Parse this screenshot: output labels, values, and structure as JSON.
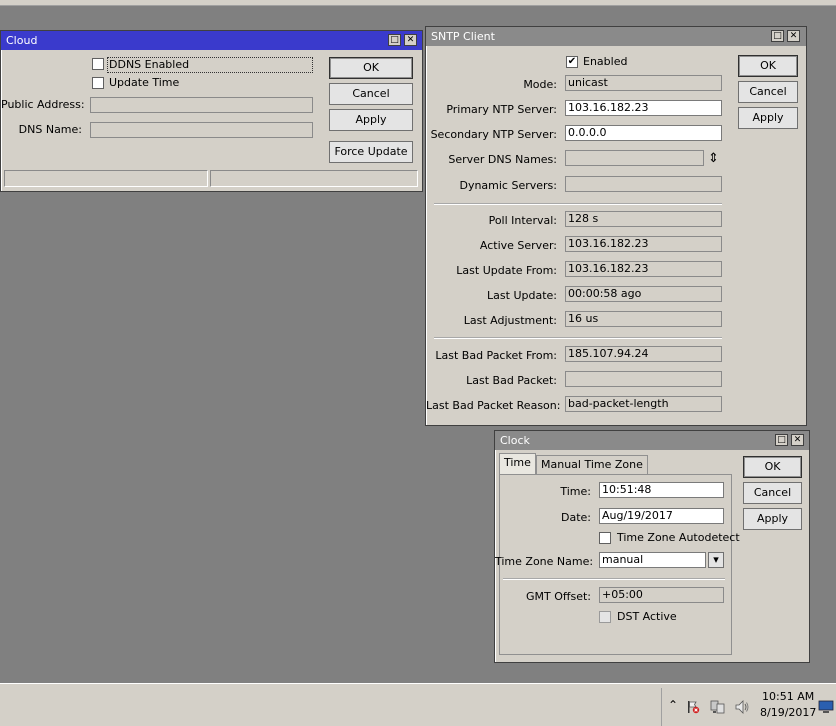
{
  "cloud": {
    "title": "Cloud",
    "ddns_enabled_label": "DDNS Enabled",
    "update_time_label": "Update Time",
    "public_address_label": "Public Address:",
    "dns_name_label": "DNS Name:",
    "public_address_value": "",
    "dns_name_value": "",
    "buttons": {
      "ok": "OK",
      "cancel": "Cancel",
      "apply": "Apply",
      "force_update": "Force Update"
    }
  },
  "sntp": {
    "title": "SNTP Client",
    "enabled_label": "Enabled",
    "enabled_checked": "✔",
    "fields": {
      "mode": {
        "label": "Mode:",
        "value": "unicast"
      },
      "primary": {
        "label": "Primary NTP Server:",
        "value": "103.16.182.23"
      },
      "secondary": {
        "label": "Secondary NTP Server:",
        "value": "0.0.0.0"
      },
      "server_dns": {
        "label": "Server DNS Names:",
        "value": ""
      },
      "dynamic": {
        "label": "Dynamic Servers:",
        "value": ""
      },
      "poll": {
        "label": "Poll Interval:",
        "value": "128 s"
      },
      "active": {
        "label": "Active Server:",
        "value": "103.16.182.23"
      },
      "last_update_from": {
        "label": "Last Update From:",
        "value": "103.16.182.23"
      },
      "last_update": {
        "label": "Last Update:",
        "value": "00:00:58 ago"
      },
      "last_adjustment": {
        "label": "Last Adjustment:",
        "value": "16 us"
      },
      "last_bad_from": {
        "label": "Last Bad Packet From:",
        "value": "185.107.94.24"
      },
      "last_bad": {
        "label": "Last Bad Packet:",
        "value": ""
      },
      "last_bad_reason": {
        "label": "Last Bad Packet Reason:",
        "value": "bad-packet-length"
      }
    },
    "buttons": {
      "ok": "OK",
      "cancel": "Cancel",
      "apply": "Apply"
    }
  },
  "clock": {
    "title": "Clock",
    "tabs": {
      "time": "Time",
      "manual_tz": "Manual Time Zone"
    },
    "time_label": "Time:",
    "time_value": "10:51:48",
    "date_label": "Date:",
    "date_value": "Aug/19/2017",
    "tz_autodetect_label": "Time Zone Autodetect",
    "tz_name_label": "Time Zone Name:",
    "tz_name_value": "manual",
    "gmt_offset_label": "GMT Offset:",
    "gmt_offset_value": "+05:00",
    "dst_label": "DST Active",
    "buttons": {
      "ok": "OK",
      "cancel": "Cancel",
      "apply": "Apply"
    }
  },
  "taskbar": {
    "time": "10:51 AM",
    "date": "8/19/2017"
  },
  "icons": {
    "maximize": "□",
    "close": "✕",
    "updown": "⇕",
    "dropdown": "▾",
    "tray_up": "⌃"
  }
}
